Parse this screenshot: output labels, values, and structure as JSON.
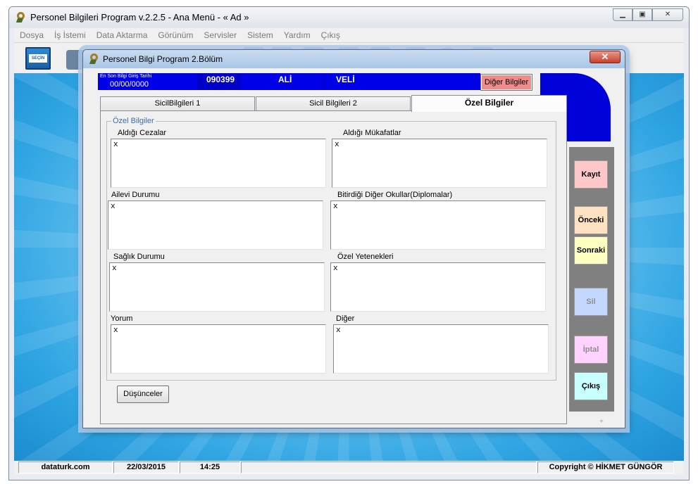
{
  "main_window": {
    "title": "Personel Bilgileri Program v.2.2.5  - Ana Menü -  « Ad »",
    "menu": [
      "Dosya",
      "İş İstemi",
      "Data Aktarma",
      "Görünüm",
      "Servisler",
      "Sistem",
      "Yardım",
      "Çıkış"
    ],
    "toolbar": {
      "select_label": "SEÇİN"
    },
    "status": {
      "site": "dataturk.com",
      "date": "22/03/2015",
      "time": "14:25",
      "copyright": "Copyright © HİKMET GÜNGÖR"
    }
  },
  "dialog": {
    "title": "Personel Bilgi Program 2.Bölüm",
    "close_label": "✕",
    "info": {
      "last_entry_label": "En Son Bilgi Giriş Tarihi",
      "last_entry_date": "00/00/0000",
      "employee_no": "090399",
      "first_name": "ALİ",
      "last_name": "VELİ"
    },
    "other_info_button": "Diğer Bilgiler",
    "tabs": [
      "SicilBilgileri 1",
      "Sicil Bilgileri 2",
      "Özel Bilgiler"
    ],
    "group_title": "Özel Bilgiler",
    "fields": [
      {
        "label": "Aldığı Cezalar",
        "value": "x"
      },
      {
        "label": "Aldığı Mükafatlar",
        "value": "x"
      },
      {
        "label": "Ailevi Durumu",
        "value": "x"
      },
      {
        "label": "Bitirdiği Diğer Okullar(Diplomalar)",
        "value": "x"
      },
      {
        "label": "Sağlık Durumu",
        "value": "x"
      },
      {
        "label": "Özel Yetenekleri",
        "value": "x"
      },
      {
        "label": "Yorum",
        "value": "x"
      },
      {
        "label": "Diğer",
        "value": "x"
      }
    ],
    "thoughts_button": "Düşünceler",
    "side_buttons": [
      {
        "label": "Kayıt",
        "color": "#ffc8c8",
        "enabled": true
      },
      {
        "label": "Önceki",
        "color": "#ffe2c2",
        "enabled": true
      },
      {
        "label": "Sonraki",
        "color": "#ffffc2",
        "enabled": true
      },
      {
        "label": "Sil",
        "color": "#c4d8ff",
        "enabled": false
      },
      {
        "label": "İptal",
        "color": "#ffd2ff",
        "enabled": false
      },
      {
        "label": "Çıkış",
        "color": "#c8ffff",
        "enabled": true
      }
    ]
  }
}
